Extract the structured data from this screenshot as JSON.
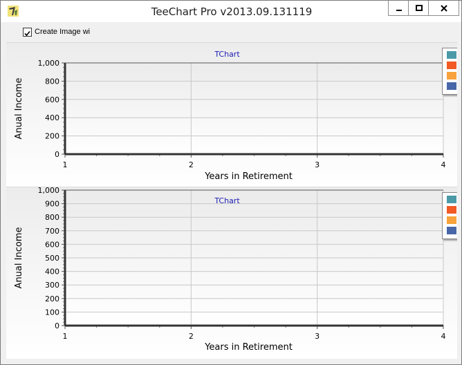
{
  "window": {
    "title": "TeeChart Pro v2013.09.131119",
    "icons": {
      "app": "teechart-logo-icon",
      "minimize": "minimize-icon",
      "maximize": "maximize-icon",
      "close": "close-icon"
    }
  },
  "toolbar": {
    "checkbox_label": "Create Image wi",
    "checked": true
  },
  "colors": {
    "series": [
      "#4a9aa7",
      "#f15a24",
      "#f7a23b",
      "#4767a8"
    ],
    "title": "#1a1ab4"
  },
  "chart_data": [
    {
      "type": "line",
      "title": "TChart",
      "xlabel": "Years in Retirement",
      "ylabel": "Anual Income",
      "xlim": [
        1,
        4
      ],
      "ylim": [
        0,
        1000
      ],
      "x_ticks": [
        "1",
        "2",
        "3",
        "4"
      ],
      "y_ticks": [
        "0",
        "200",
        "400",
        "600",
        "800",
        "1,000"
      ],
      "grid": true,
      "legend": "right",
      "series": [
        {
          "values": []
        },
        {
          "values": []
        },
        {
          "values": []
        },
        {
          "values": []
        }
      ]
    },
    {
      "type": "line",
      "title": "TChart",
      "xlabel": "Years in Retirement",
      "ylabel": "Anual Income",
      "xlim": [
        1,
        4
      ],
      "ylim": [
        0,
        1000
      ],
      "x_ticks": [
        "1",
        "2",
        "3",
        "4"
      ],
      "y_ticks": [
        "0",
        "100",
        "200",
        "300",
        "400",
        "500",
        "600",
        "700",
        "800",
        "900",
        "1,000"
      ],
      "grid": true,
      "legend": "right",
      "series": [
        {
          "values": []
        },
        {
          "values": []
        },
        {
          "values": []
        },
        {
          "values": []
        }
      ]
    }
  ]
}
